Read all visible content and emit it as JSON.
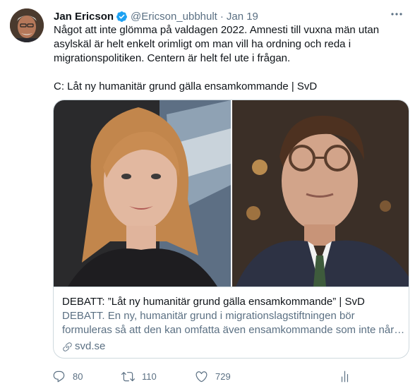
{
  "author": {
    "name": "Jan Ericson",
    "handle": "@Ericson_ubbhult",
    "separator": "·",
    "date": "Jan 19"
  },
  "tweet": {
    "line1": "Något att inte glömma på valdagen 2022. Amnesti till vuxna män utan",
    "line2": "asylskäl är helt enkelt orimligt om man vill ha ordning och reda i",
    "line3": "migrationspolitiken. Centern är helt fel ute i frågan.",
    "line4": "C: Låt ny humanitär grund gälla ensamkommande | SvD"
  },
  "card": {
    "title": "DEBATT: ”Låt ny humanitär grund gälla ensamkommande” | SvD",
    "desc_line1": "DEBATT. En ny, humanitär grund i migrationslagstiftningen bör",
    "desc_line2": "formuleras så att den kan omfatta även ensamkommande som inte når…",
    "domain": "svd.se"
  },
  "actions": {
    "replies": "80",
    "retweets": "110",
    "likes": "729"
  },
  "colors": {
    "text": "#0f1419",
    "secondary": "#5b7083",
    "verified": "#1da1f2",
    "border": "#cfd9de"
  },
  "icons": [
    "verified-badge-icon",
    "more-icon",
    "link-icon",
    "reply-icon",
    "retweet-icon",
    "like-icon",
    "analytics-icon"
  ]
}
